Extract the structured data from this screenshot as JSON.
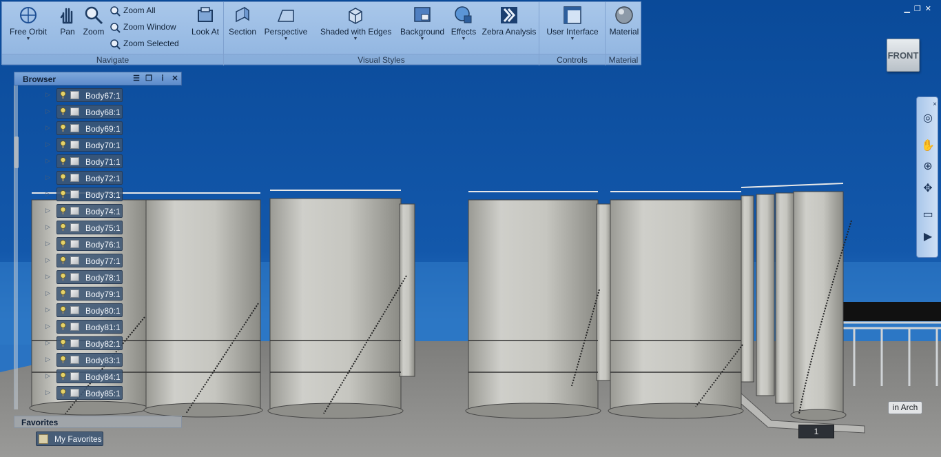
{
  "ribbon": {
    "navigate": {
      "group_label": "Navigate",
      "free_orbit": "Free Orbit",
      "pan": "Pan",
      "zoom": "Zoom",
      "zoom_all": "Zoom All",
      "zoom_window": "Zoom Window",
      "zoom_selected": "Zoom Selected",
      "look_at": "Look At"
    },
    "visual_styles": {
      "group_label": "Visual Styles",
      "section": "Section",
      "perspective": "Perspective",
      "shaded_with_edges": "Shaded with Edges",
      "background": "Background",
      "effects": "Effects",
      "zebra_analysis": "Zebra Analysis"
    },
    "controls": {
      "group_label": "Controls",
      "user_interface": "User Interface"
    },
    "material": {
      "group_label": "Material",
      "material": "Material"
    }
  },
  "window_controls": [
    "minimize-icon",
    "restore-icon",
    "close-icon"
  ],
  "viewcube": {
    "face": "FRONT"
  },
  "browser": {
    "title": "Browser",
    "items": [
      {
        "label": "Body67:1"
      },
      {
        "label": "Body68:1"
      },
      {
        "label": "Body69:1"
      },
      {
        "label": "Body70:1"
      },
      {
        "label": "Body71:1"
      },
      {
        "label": "Body72:1"
      },
      {
        "label": "Body73:1"
      },
      {
        "label": "Body74:1"
      },
      {
        "label": "Body75:1"
      },
      {
        "label": "Body76:1"
      },
      {
        "label": "Body77:1"
      },
      {
        "label": "Body78:1"
      },
      {
        "label": "Body79:1"
      },
      {
        "label": "Body80:1"
      },
      {
        "label": "Body81:1"
      },
      {
        "label": "Body82:1"
      },
      {
        "label": "Body83:1"
      },
      {
        "label": "Body84:1"
      },
      {
        "label": "Body85:1"
      }
    ]
  },
  "favorites": {
    "title": "Favorites",
    "item": "My Favorites"
  },
  "viewport": {
    "page_number": "1",
    "arch_label": "in Arch"
  },
  "colors": {
    "sky": "#0d4c9a",
    "ground": "#8e8e8c",
    "tank": "#c9c9c3",
    "ribbon": "#9dbde6"
  }
}
